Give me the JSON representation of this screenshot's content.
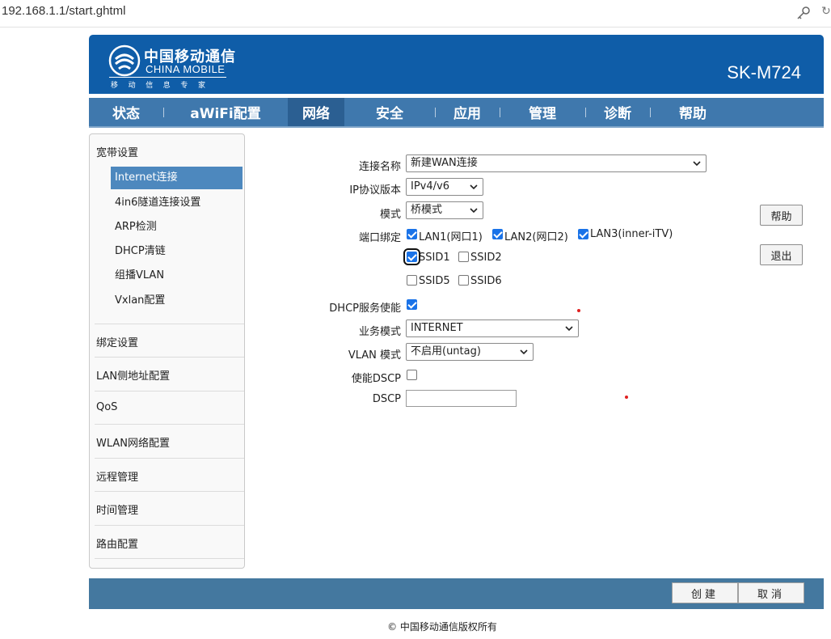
{
  "browser": {
    "url": "192.168.1.1/start.ghtml",
    "key_icon": "key-icon"
  },
  "header": {
    "brand_cn": "中国移动通信",
    "brand_en": "CHINA MOBILE",
    "brand_sub": "移动信息专家",
    "model": "SK-M724",
    "bg_color": "#0f5da8"
  },
  "nav": {
    "tabs": [
      {
        "label": "状态"
      },
      {
        "label": "aWiFi配置"
      },
      {
        "label": "网络",
        "active": true
      },
      {
        "label": "安全"
      },
      {
        "label": "应用"
      },
      {
        "label": "管理"
      },
      {
        "label": "诊断"
      },
      {
        "label": "帮助"
      }
    ]
  },
  "sidebar": {
    "group1": "宽带设置",
    "items": [
      {
        "label": "Internet连接",
        "active": true
      },
      {
        "label": "4in6隧道连接设置"
      },
      {
        "label": "ARP检测"
      },
      {
        "label": "DHCP清链"
      },
      {
        "label": "组播VLAN"
      },
      {
        "label": "Vxlan配置"
      }
    ],
    "groups": [
      "绑定设置",
      "LAN侧地址配置",
      "QoS",
      "WLAN网络配置",
      "远程管理",
      "时间管理",
      "路由配置"
    ]
  },
  "form": {
    "conn_name_label": "连接名称",
    "conn_name_value": "新建WAN连接",
    "ip_version_label": "IP协议版本",
    "ip_version_value": "IPv4/v6",
    "mode_label": "模式",
    "mode_value": "桥模式",
    "port_bind_label": "端口绑定",
    "ports": [
      {
        "label": "LAN1(网口1)",
        "checked": true
      },
      {
        "label": "LAN2(网口2)",
        "checked": true
      },
      {
        "label": "LAN3(inner-iTV)",
        "checked": true
      },
      {
        "label": "SSID1",
        "checked": true
      },
      {
        "label": "SSID2",
        "checked": false
      },
      {
        "label": "SSID5",
        "checked": false
      },
      {
        "label": "SSID6",
        "checked": false
      }
    ],
    "dhcp_label": "DHCP服务使能",
    "dhcp_checked": true,
    "service_mode_label": "业务模式",
    "service_mode_value": "INTERNET",
    "vlan_mode_label": "VLAN 模式",
    "vlan_mode_value": "不启用(untag)",
    "dscp_enable_label": "使能DSCP",
    "dscp_enable_checked": false,
    "dscp_label": "DSCP",
    "dscp_value": ""
  },
  "side_buttons": {
    "help": "帮助",
    "exit": "退出"
  },
  "footer": {
    "create": "创建",
    "cancel": "取消",
    "copyright": "© 中国移动通信版权所有"
  }
}
